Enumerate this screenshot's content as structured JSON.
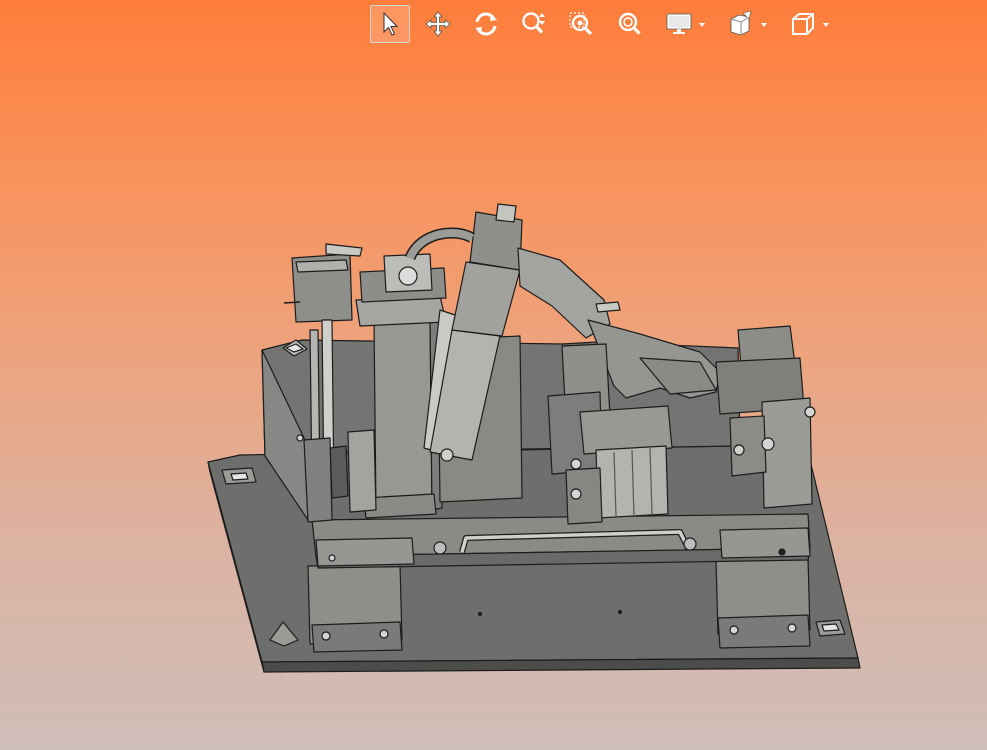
{
  "window": {
    "background_top": "#ff7d3a",
    "background_bottom": "#cfbeb9"
  },
  "toolbar": {
    "tools": [
      {
        "id": "select",
        "icon": "pointer-arrow-icon",
        "active": true
      },
      {
        "id": "pan",
        "icon": "move-arrows-icon",
        "active": false
      },
      {
        "id": "rotate",
        "icon": "rotate-icon",
        "active": false
      },
      {
        "id": "zoom",
        "icon": "zoom-updown-icon",
        "active": false
      },
      {
        "id": "zoom-window",
        "icon": "zoom-window-icon",
        "active": false
      },
      {
        "id": "zoom-fit",
        "icon": "zoom-fit-icon",
        "active": false
      },
      {
        "id": "display",
        "icon": "monitor-icon",
        "has_dropdown": true
      },
      {
        "id": "render-mode",
        "icon": "render-style-icon",
        "has_dropdown": true
      },
      {
        "id": "view-orientation",
        "icon": "cube-view-icon",
        "has_dropdown": true
      }
    ]
  },
  "model": {
    "description_icon": "cad-fixture-assembly",
    "body_color": "#8f8f8c",
    "plate_color": "#6f6f6d",
    "edge_color": "#1c1c1c"
  }
}
